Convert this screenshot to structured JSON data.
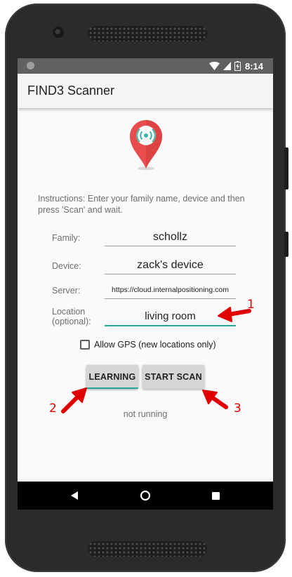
{
  "status_bar": {
    "time": "8:14",
    "icons": [
      "notification-dot-icon",
      "wifi-icon",
      "cell-signal-icon",
      "battery-icon"
    ]
  },
  "app_bar": {
    "title": "FIND3 Scanner"
  },
  "logo": {
    "icon": "location-pin-wifi-icon",
    "pin_color": "#e84c4c"
  },
  "instructions": "Instructions: Enter your family name, device and then press 'Scan' and wait.",
  "form": {
    "family": {
      "label": "Family:",
      "value": "schollz"
    },
    "device": {
      "label": "Device:",
      "value": "zack's device"
    },
    "server": {
      "label": "Server:",
      "value": "https://cloud.internalpositioning.com"
    },
    "location": {
      "label_line1": "Location",
      "label_line2": "(optional):",
      "value": "living room"
    }
  },
  "gps_checkbox": {
    "label": "Allow GPS (new locations only)",
    "checked": false
  },
  "buttons": {
    "learning": "LEARNING",
    "start_scan": "START SCAN"
  },
  "status_text": "not running",
  "navigation": {
    "icons": [
      "back-icon",
      "home-icon",
      "recents-icon"
    ]
  },
  "annotations": {
    "one": "1",
    "two": "2",
    "three": "3",
    "color": "#e00000"
  },
  "colors": {
    "accent": "#26a69a",
    "status_bar": "#616161",
    "app_bar": "#f5f5f5",
    "button": "#d6d6d6"
  }
}
